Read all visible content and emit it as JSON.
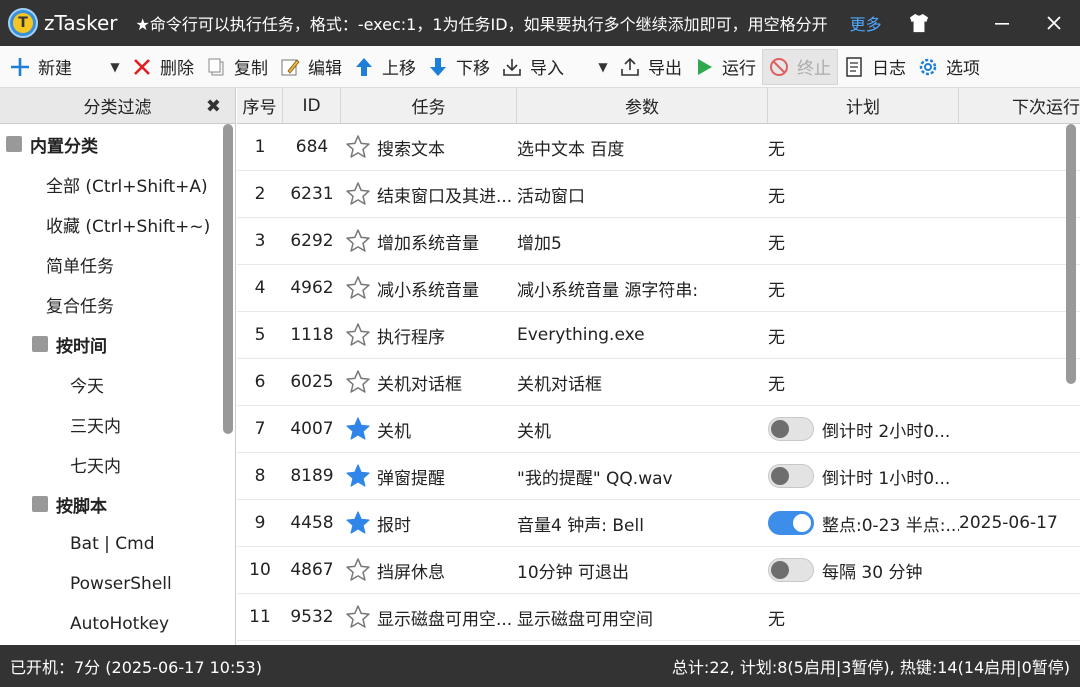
{
  "titlebar": {
    "app_name": "zTasker",
    "message": "★命令行可以执行任务，格式：-exec:1，1为任务ID，如果要执行多个继续添加即可，用空格分开",
    "more": "更多"
  },
  "toolbar": {
    "new": "新建",
    "delete": "删除",
    "copy": "复制",
    "edit": "编辑",
    "up": "上移",
    "down": "下移",
    "import": "导入",
    "export": "导出",
    "run": "运行",
    "stop": "终止",
    "log": "日志",
    "options": "选项"
  },
  "sidebar": {
    "title": "分类过滤",
    "items": [
      {
        "label": "内置分类",
        "level": "g0"
      },
      {
        "label": "全部 (Ctrl+Shift+A)",
        "level": "1"
      },
      {
        "label": "收藏 (Ctrl+Shift+~)",
        "level": "1"
      },
      {
        "label": "简单任务",
        "level": "1"
      },
      {
        "label": "复合任务",
        "level": "1"
      },
      {
        "label": "按时间",
        "level": "g1"
      },
      {
        "label": "今天",
        "level": "2"
      },
      {
        "label": "三天内",
        "level": "2"
      },
      {
        "label": "七天内",
        "level": "2"
      },
      {
        "label": "按脚本",
        "level": "g1"
      },
      {
        "label": "Bat | Cmd",
        "level": "2"
      },
      {
        "label": "PowserShell",
        "level": "2"
      },
      {
        "label": "AutoHotkey",
        "level": "2"
      }
    ]
  },
  "table": {
    "columns": [
      "序号",
      "ID",
      "任务",
      "参数",
      "计划",
      "下次运行"
    ],
    "rows": [
      {
        "no": "1",
        "id": "684",
        "starred": false,
        "task": "搜索文本",
        "param": "选中文本 百度",
        "toggle": "none",
        "plan": "无",
        "next": ""
      },
      {
        "no": "2",
        "id": "6231",
        "starred": false,
        "task": "结束窗口及其进...",
        "param": "活动窗口",
        "toggle": "none",
        "plan": "无",
        "next": ""
      },
      {
        "no": "3",
        "id": "6292",
        "starred": false,
        "task": "增加系统音量",
        "param": "增加5",
        "toggle": "none",
        "plan": "无",
        "next": ""
      },
      {
        "no": "4",
        "id": "4962",
        "starred": false,
        "task": "减小系统音量",
        "param": "减小系统音量 源字符串:",
        "toggle": "none",
        "plan": "无",
        "next": ""
      },
      {
        "no": "5",
        "id": "1118",
        "starred": false,
        "task": "执行程序",
        "param": "Everything.exe",
        "toggle": "none",
        "plan": "无",
        "next": ""
      },
      {
        "no": "6",
        "id": "6025",
        "starred": false,
        "task": "关机对话框",
        "param": "关机对话框",
        "toggle": "none",
        "plan": "无",
        "next": ""
      },
      {
        "no": "7",
        "id": "4007",
        "starred": true,
        "task": "关机",
        "param": "关机",
        "toggle": "off",
        "plan": "倒计时 2小时0...",
        "next": ""
      },
      {
        "no": "8",
        "id": "8189",
        "starred": true,
        "task": "弹窗提醒",
        "param": "\"我的提醒\" QQ.wav",
        "toggle": "off",
        "plan": "倒计时 1小时0...",
        "next": ""
      },
      {
        "no": "9",
        "id": "4458",
        "starred": true,
        "task": "报时",
        "param": "音量4 钟声: Bell",
        "toggle": "on",
        "plan": "整点:0-23 半点:...",
        "next": "2025-06-17"
      },
      {
        "no": "10",
        "id": "4867",
        "starred": false,
        "task": "挡屏休息",
        "param": "10分钟 可退出",
        "toggle": "off",
        "plan": "每隔 30 分钟",
        "next": ""
      },
      {
        "no": "11",
        "id": "9532",
        "starred": false,
        "task": "显示磁盘可用空...",
        "param": "显示磁盘可用空间",
        "toggle": "none",
        "plan": "无",
        "next": ""
      }
    ]
  },
  "statusbar": {
    "left": "已开机：7分 (2025-06-17 10:53)",
    "right": "总计:22, 计划:8(5启用|3暂停), 热键:14(14启用|0暂停)"
  },
  "colors": {
    "titlebar_bg": "#333333",
    "accent_blue": "#3d8eea",
    "run_green": "#2fa84f",
    "delete_red": "#e02020"
  }
}
